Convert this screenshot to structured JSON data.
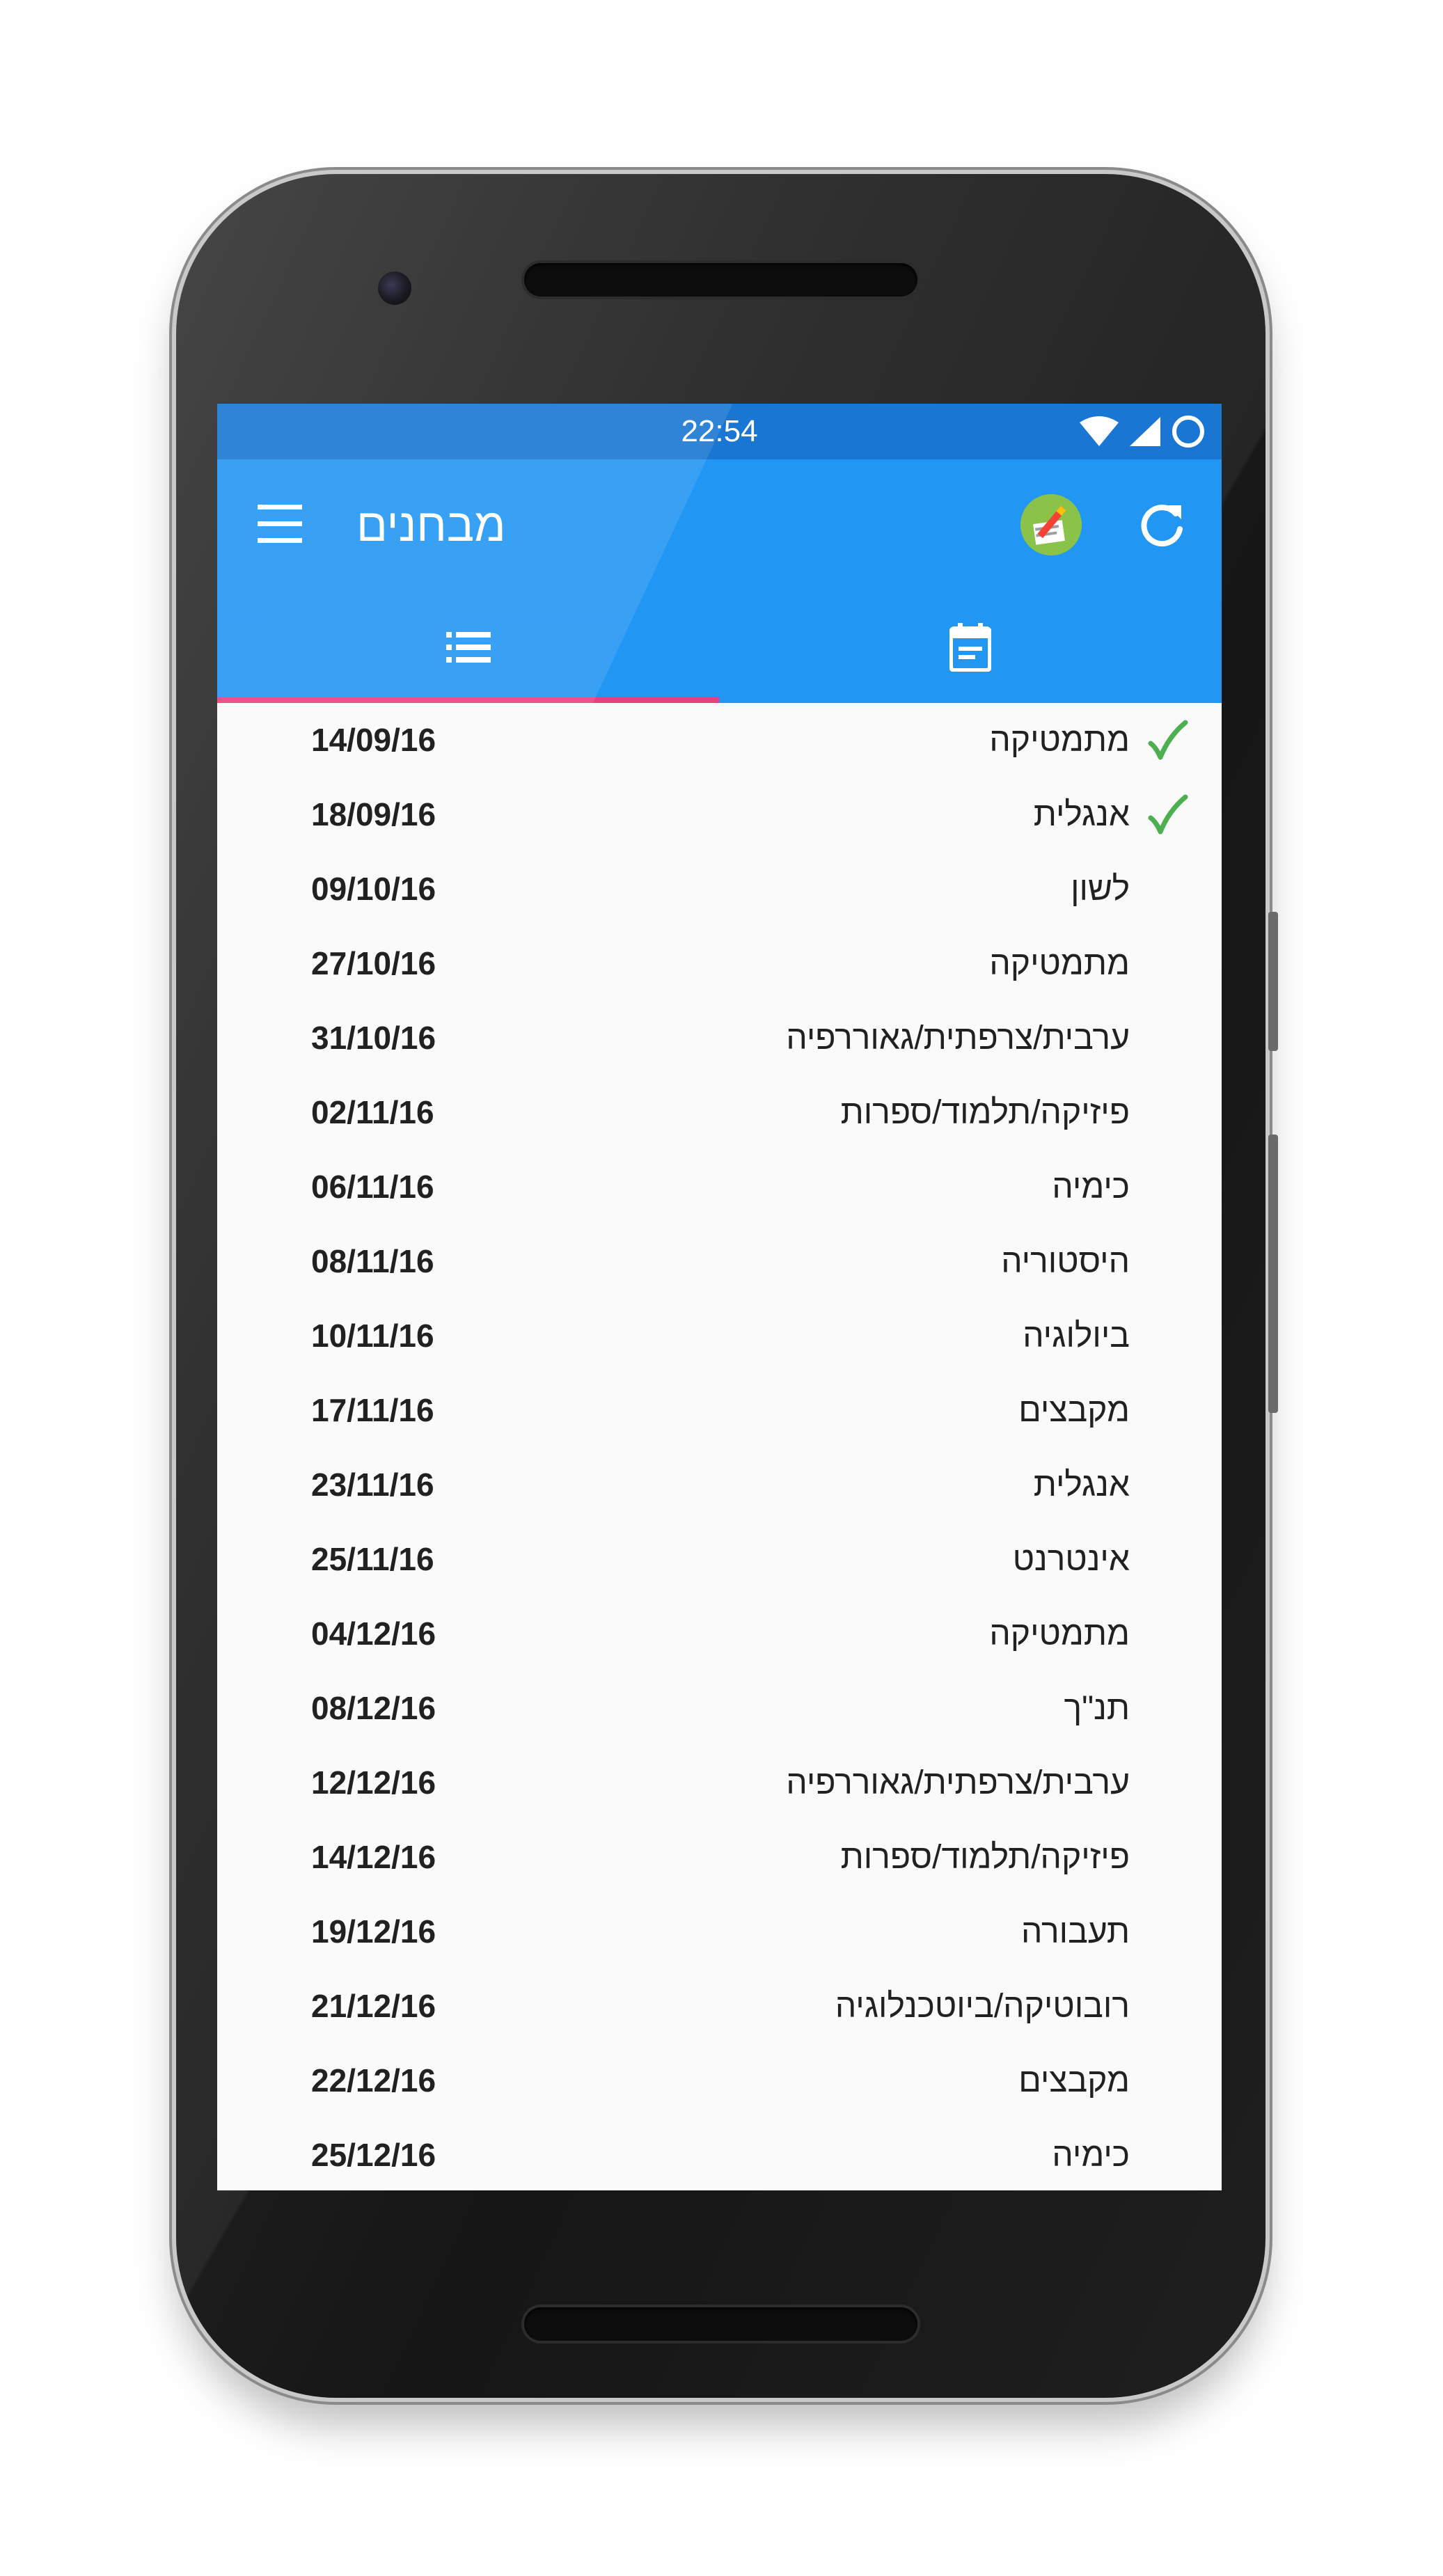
{
  "status_bar": {
    "time": "22:54"
  },
  "toolbar": {
    "title": "מבחנים",
    "menu_icon": "hamburger-menu-icon",
    "app_icon": "app-logo-icon",
    "refresh_icon": "refresh-icon"
  },
  "tabs": [
    {
      "icon": "list-icon",
      "selected": true
    },
    {
      "icon": "calendar-icon",
      "selected": false
    }
  ],
  "colors": {
    "status_bar": "#1976d2",
    "primary": "#2196f3",
    "tab_indicator": "#ec407a",
    "check": "#4caf50",
    "background": "#fafafa",
    "text": "#212121"
  },
  "exams": [
    {
      "subject": "מתמטיקה",
      "date": "14/09/16",
      "done": true
    },
    {
      "subject": "אנגלית",
      "date": "18/09/16",
      "done": true
    },
    {
      "subject": "לשון",
      "date": "09/10/16",
      "done": false
    },
    {
      "subject": "מתמטיקה",
      "date": "27/10/16",
      "done": false
    },
    {
      "subject": "ערבית/צרפתית/גאוררפיה",
      "date": "31/10/16",
      "done": false
    },
    {
      "subject": "פיזיקה/תלמוד/ספרות",
      "date": "02/11/16",
      "done": false
    },
    {
      "subject": "כימיה",
      "date": "06/11/16",
      "done": false
    },
    {
      "subject": "היסטוריה",
      "date": "08/11/16",
      "done": false
    },
    {
      "subject": "ביולוגיה",
      "date": "10/11/16",
      "done": false
    },
    {
      "subject": "מקבצים",
      "date": "17/11/16",
      "done": false
    },
    {
      "subject": "אנגלית",
      "date": "23/11/16",
      "done": false
    },
    {
      "subject": "אינטרנט",
      "date": "25/11/16",
      "done": false
    },
    {
      "subject": "מתמטיקה",
      "date": "04/12/16",
      "done": false
    },
    {
      "subject": "תנ\"ך",
      "date": "08/12/16",
      "done": false
    },
    {
      "subject": "ערבית/צרפתית/גאוררפיה",
      "date": "12/12/16",
      "done": false
    },
    {
      "subject": "פיזיקה/תלמוד/ספרות",
      "date": "14/12/16",
      "done": false
    },
    {
      "subject": "תעבורה",
      "date": "19/12/16",
      "done": false
    },
    {
      "subject": "רובוטיקה/ביוטכנלוגיה",
      "date": "21/12/16",
      "done": false
    },
    {
      "subject": "מקבצים",
      "date": "22/12/16",
      "done": false
    },
    {
      "subject": "כימיה",
      "date": "25/12/16",
      "done": false
    }
  ]
}
